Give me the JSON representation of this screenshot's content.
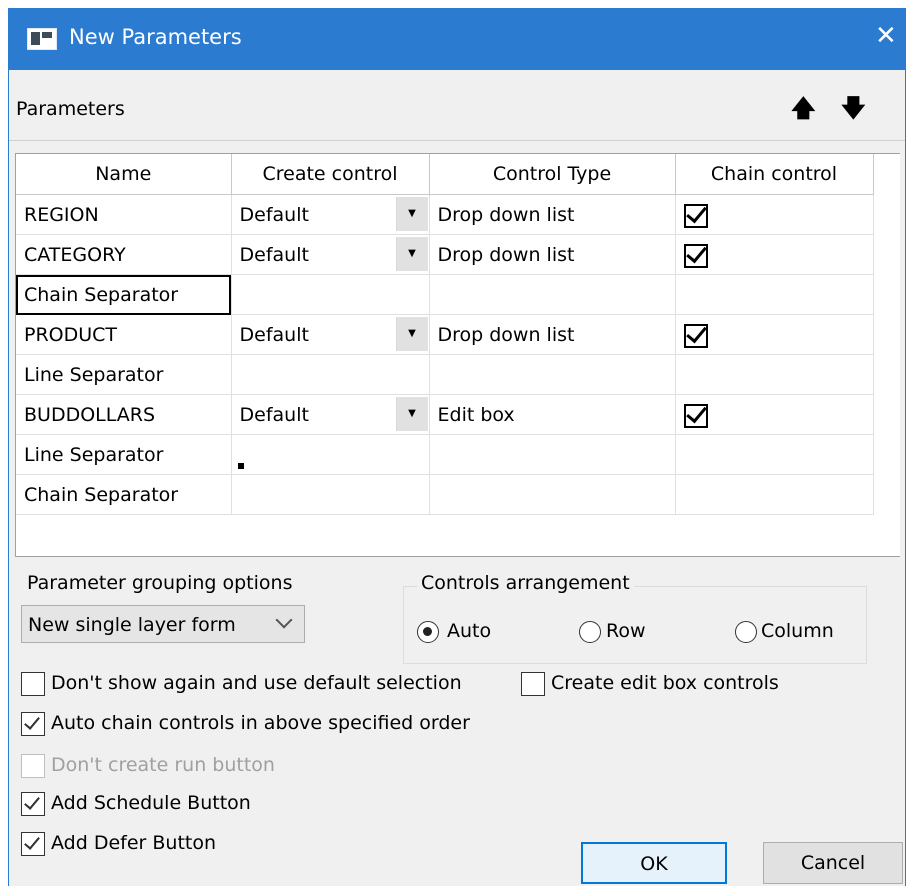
{
  "window": {
    "title": "New Parameters",
    "close_icon": "close-icon"
  },
  "section": {
    "label": "Parameters",
    "move_up_icon": "arrow-up-icon",
    "move_down_icon": "arrow-down-icon"
  },
  "table": {
    "columns": [
      "Name",
      "Create control",
      "Control Type",
      "Chain control"
    ],
    "rows": [
      {
        "name": "REGION",
        "create_control": "Default",
        "control_type": "Drop down list",
        "chain": true
      },
      {
        "name": "CATEGORY",
        "create_control": "Default",
        "control_type": "Drop down list",
        "chain": true
      },
      {
        "name": "Chain Separator",
        "create_control": "",
        "control_type": "",
        "chain": false,
        "selected": true
      },
      {
        "name": "PRODUCT",
        "create_control": "Default",
        "control_type": "Drop down list",
        "chain": true
      },
      {
        "name": "Line Separator",
        "create_control": "",
        "control_type": "",
        "chain": false
      },
      {
        "name": "BUDDOLLARS",
        "create_control": "Default",
        "control_type": "Edit box",
        "chain": true
      },
      {
        "name": "Line Separator",
        "create_control": "",
        "control_type": "",
        "chain": false
      },
      {
        "name": "Chain Separator",
        "create_control": "",
        "control_type": "",
        "chain": false
      }
    ]
  },
  "grouping": {
    "label": "Parameter grouping options",
    "selected": "New single layer form"
  },
  "arrangement": {
    "label": "Controls arrangement",
    "options": [
      {
        "label": "Auto",
        "selected": true
      },
      {
        "label": "Row",
        "selected": false
      },
      {
        "label": "Column",
        "selected": false
      }
    ]
  },
  "options": {
    "dont_show_again": {
      "label": "Don't show again and use default selection",
      "checked": false
    },
    "create_edit_box": {
      "label": "Create edit box controls",
      "checked": false
    },
    "auto_chain": {
      "label": "Auto chain controls in above specified order",
      "checked": true
    },
    "dont_create_run": {
      "label": "Don't create run button",
      "checked": false,
      "disabled": true
    },
    "add_schedule": {
      "label": "Add Schedule Button",
      "checked": true
    },
    "add_defer": {
      "label": "Add Defer Button",
      "checked": true
    }
  },
  "buttons": {
    "ok": "OK",
    "cancel": "Cancel"
  }
}
